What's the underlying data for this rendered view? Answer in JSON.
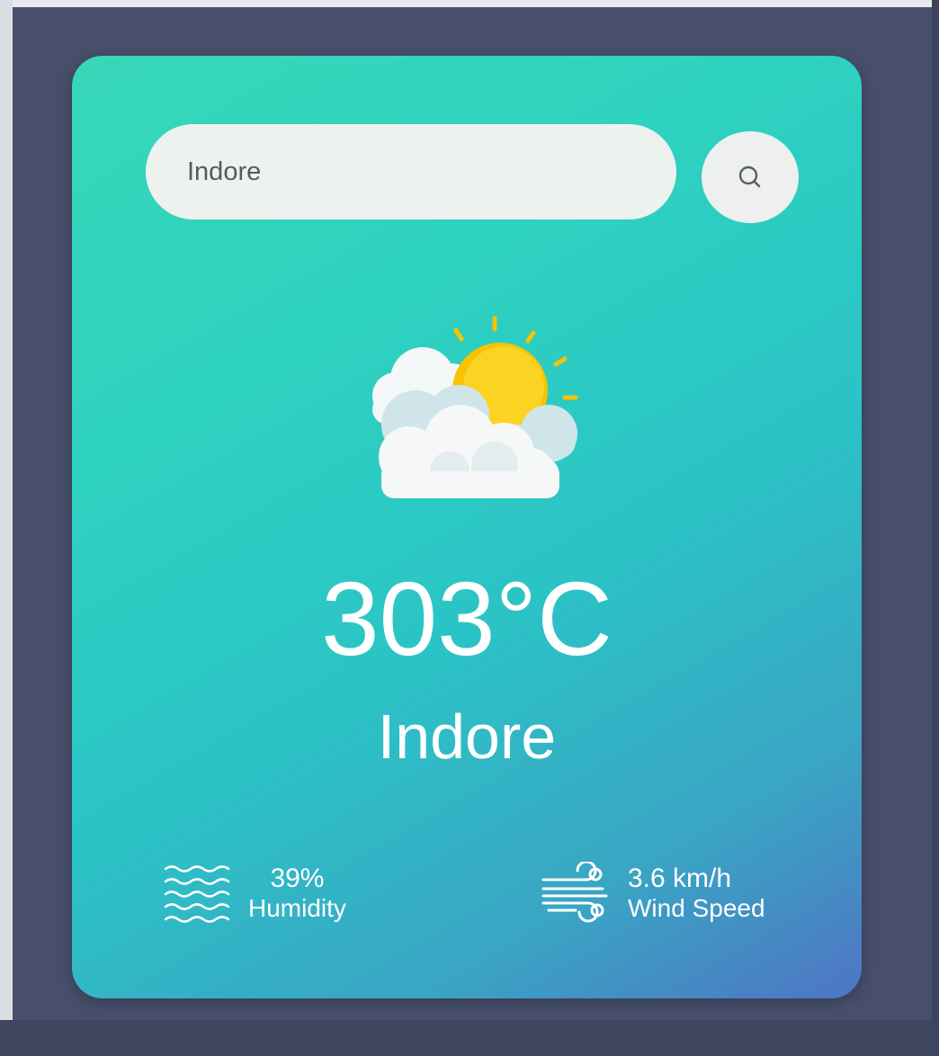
{
  "search": {
    "value": "Indore"
  },
  "weather": {
    "icon": "sun-behind-clouds-icon",
    "temperature": "303°C",
    "city": "Indore"
  },
  "humidity": {
    "value": "39%",
    "label": "Humidity",
    "icon": "humidity-waves-icon"
  },
  "wind": {
    "value": "3.6 km/h",
    "label": "Wind Speed",
    "icon": "wind-icon"
  },
  "colors": {
    "card_gradient_start": "#38d7b8",
    "card_gradient_end": "#4f74c4",
    "page_background": "#474f6b",
    "search_background": "#edf2ef",
    "sun": "#f7c300",
    "text": "#ffffff"
  }
}
